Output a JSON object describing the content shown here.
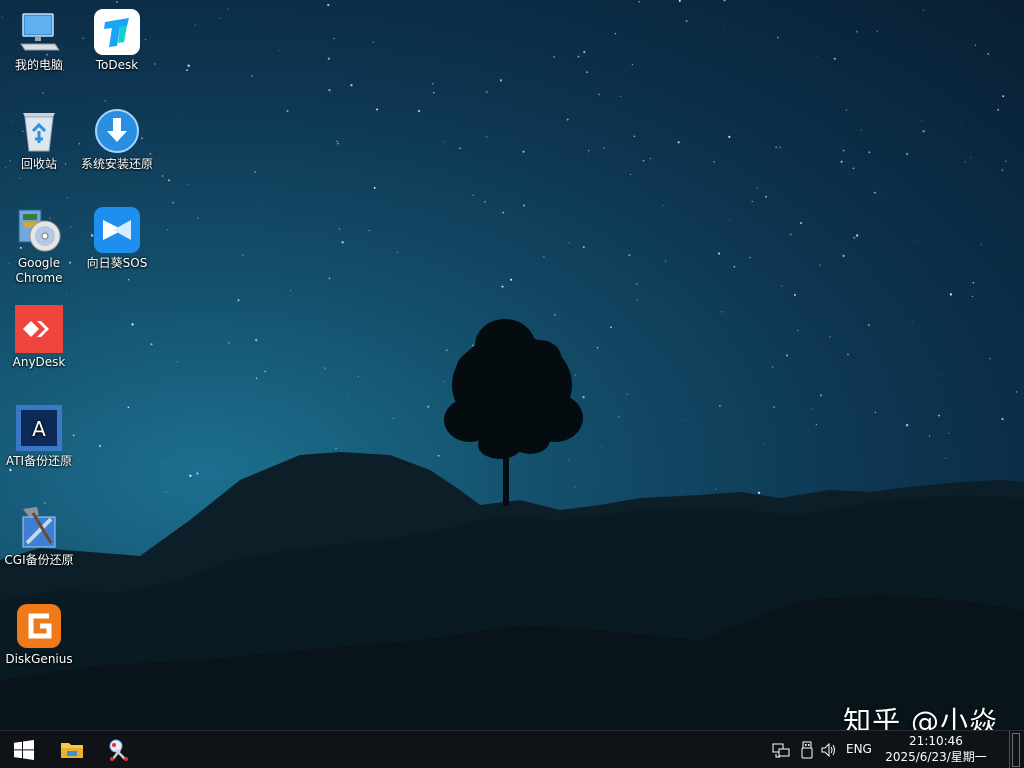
{
  "desktop": {
    "icons": [
      {
        "label": "我的电脑",
        "icon": "computer-icon"
      },
      {
        "label": "ToDesk",
        "icon": "todesk-icon"
      },
      {
        "label": "回收站",
        "icon": "recycle-bin-icon"
      },
      {
        "label": "系统安装还原",
        "icon": "install-restore-icon"
      },
      {
        "label": "Google Chrome",
        "icon": "google-chrome-installer-icon"
      },
      {
        "label": "向日葵SOS",
        "icon": "sunflower-sos-icon"
      },
      {
        "label": "AnyDesk",
        "icon": "anydesk-icon"
      },
      {
        "label": "ATI备份还原",
        "icon": "acronis-icon"
      },
      {
        "label": "CGI备份还原",
        "icon": "cgi-icon"
      },
      {
        "label": "DiskGenius",
        "icon": "diskgenius-icon"
      }
    ],
    "watermark": "知乎 @小焱"
  },
  "taskbar": {
    "items": [
      {
        "icon": "windows-start-icon"
      },
      {
        "icon": "file-explorer-icon"
      },
      {
        "icon": "snipping-tool-icon"
      }
    ],
    "tray": {
      "icons": [
        "network-icon",
        "usb-device-icon",
        "volume-icon"
      ],
      "language": "ENG",
      "time": "21:10:46",
      "date": "2025/6/23/星期一"
    }
  },
  "colors": {
    "sky_top": "#091f33",
    "sky_glow": "#1d6f8f",
    "taskbar": "#0f1317",
    "anydesk": "#ef443b",
    "todesk": "#1ba4f5",
    "diskgenius": "#f07a1a"
  }
}
